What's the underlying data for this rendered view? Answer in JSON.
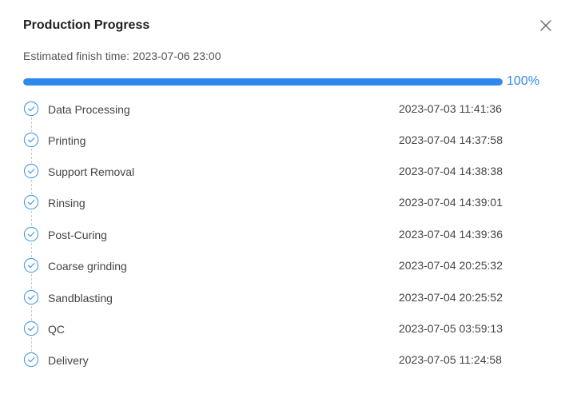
{
  "dialog": {
    "title": "Production Progress",
    "close_icon": "close-icon",
    "estimated_finish": "Estimated finish time: 2023-07-06 23:00",
    "progress": {
      "percent": 100,
      "label": "100%"
    }
  },
  "steps": [
    {
      "label": "Data Processing",
      "time": "2023-07-03 11:41:36",
      "status": "done",
      "icon": "check-circle-icon"
    },
    {
      "label": "Printing",
      "time": "2023-07-04 14:37:58",
      "status": "done",
      "icon": "check-circle-icon"
    },
    {
      "label": "Support Removal",
      "time": "2023-07-04 14:38:38",
      "status": "done",
      "icon": "check-circle-icon"
    },
    {
      "label": "Rinsing",
      "time": "2023-07-04 14:39:01",
      "status": "done",
      "icon": "check-circle-icon"
    },
    {
      "label": "Post-Curing",
      "time": "2023-07-04 14:39:36",
      "status": "done",
      "icon": "check-circle-icon"
    },
    {
      "label": "Coarse grinding",
      "time": "2023-07-04 20:25:32",
      "status": "done",
      "icon": "check-circle-icon"
    },
    {
      "label": "Sandblasting",
      "time": "2023-07-04 20:25:52",
      "status": "done",
      "icon": "check-circle-icon"
    },
    {
      "label": "QC",
      "time": "2023-07-05 03:59:13",
      "status": "done",
      "icon": "check-circle-icon"
    },
    {
      "label": "Delivery",
      "time": "2023-07-05 11:24:58",
      "status": "done",
      "icon": "check-circle-icon"
    }
  ],
  "colors": {
    "accent": "#2f88ec",
    "check": "#4a9ae8"
  }
}
